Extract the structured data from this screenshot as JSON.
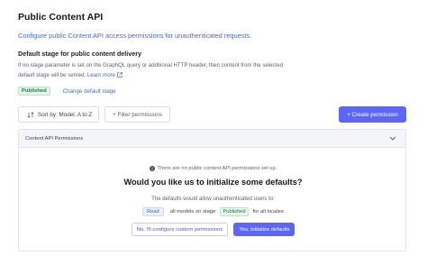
{
  "header": {
    "title": "Public Content API",
    "subtitle": "Configure public Content API access permissions for unauthenticated requests."
  },
  "default_stage": {
    "title": "Default stage for public content delivery",
    "description": "If no stage parameter is set on the GraphQL query or additional HTTP header, then content from the selected default stage will be served.",
    "learn_more": "Learn more",
    "stage_badge": "Published",
    "change_link": "Change default stage"
  },
  "toolbar": {
    "sort_label": "Sort by: Model: A to Z",
    "filter_label": "+ Filter permissions",
    "create_label": "+ Create permission"
  },
  "panel": {
    "header_label": "Content API Permissions",
    "notice": "There are no public content API permissions set up.",
    "question": "Would you like us to initialize some defaults?",
    "allow_text": "The defaults would allow unauthenticated users to:",
    "perm_action": "Read",
    "perm_models": "all models on stage",
    "perm_stage": "Published",
    "perm_locales": "for all locales",
    "custom_button": "No, I'll configure custom permissions",
    "init_button": "Yes, initialize defaults"
  },
  "colors": {
    "primary": "#5c67f2",
    "link": "#4a6bc8",
    "published_bg": "#e6f6ec",
    "published_text": "#1f7a40"
  }
}
